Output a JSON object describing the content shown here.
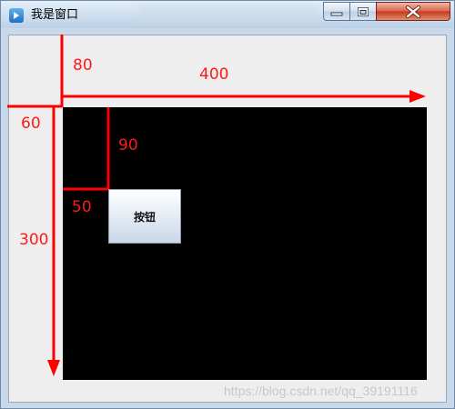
{
  "window": {
    "title": "我是窗口",
    "icon": "java-app-icon",
    "controls": {
      "minimize": "minimize-icon",
      "maximize": "maximize-icon",
      "close": "close-icon"
    }
  },
  "content": {
    "panel_color": "#000000",
    "button_label": "按钮"
  },
  "annotations": {
    "color": "#ff0000",
    "left_offset": "60",
    "top_offset": "80",
    "width": "400",
    "height": "300",
    "button_x": "50",
    "button_y": "90"
  },
  "watermark": "https://blog.csdn.net/qq_39191116"
}
